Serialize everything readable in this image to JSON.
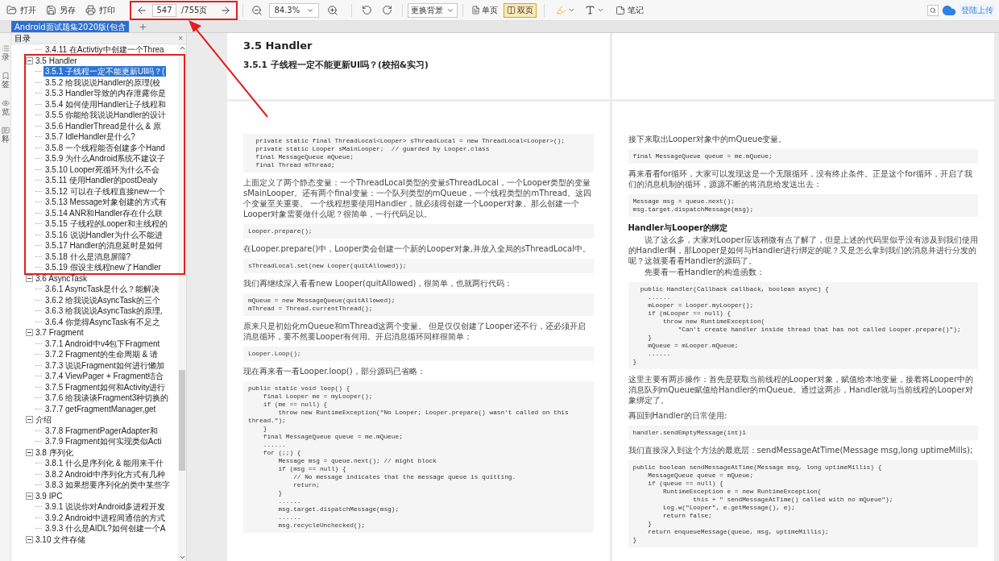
{
  "toolbar": {
    "file_buttons": [
      {
        "label": "打开"
      },
      {
        "label": "另存"
      },
      {
        "label": "打印"
      }
    ],
    "page_input": {
      "value": "547"
    },
    "page_total": "/755页",
    "zoom": {
      "value": "84.3%"
    },
    "background_button": "更换背景",
    "view_modes": [
      {
        "label": "单页",
        "selected": false
      },
      {
        "label": "双页",
        "selected": true
      }
    ],
    "note_button": "笔记",
    "upload_button": "登陆上传"
  },
  "document_tab": {
    "title": "Android面试题集2020版(包含"
  },
  "rail_tabs": [
    {
      "label": "录"
    },
    {
      "label": "签"
    },
    {
      "label": "览"
    },
    {
      "label": "释"
    }
  ],
  "sidebar": {
    "title": "目录",
    "close": "×",
    "items": [
      {
        "label": "3.4.11 在Activtiy中创建一个Threa",
        "selected": false
      },
      {
        "label": "3.5 Handler",
        "expanded": true,
        "children": [
          {
            "label": "3.5.1 子线程一定不能更新UI吗？(",
            "selected": true
          },
          {
            "label": "3.5.2 给我说说Handler的原理(校",
            "selected": false
          },
          {
            "label": "3.5.3 Handler导致的内存泄露你是",
            "selected": false
          },
          {
            "label": "3.5.4 如何使用Handler让子线程和",
            "selected": false
          },
          {
            "label": "3.5.5 你能给我说说Handler的设计",
            "selected": false
          },
          {
            "label": "3.5.6 HandlerThread是什么 & 原",
            "selected": false
          },
          {
            "label": "3.5.7 IdleHandler是什么?",
            "selected": false
          },
          {
            "label": "3.5.8 一个线程能否创建多个Hand",
            "selected": false
          },
          {
            "label": "3.5.9 为什么Android系统不建议子",
            "selected": false
          },
          {
            "label": "3.5.10 Looper死循环为什么不会",
            "selected": false
          },
          {
            "label": "3.5.11 使用Handler的postDealy",
            "selected": false
          },
          {
            "label": "3.5.12 可以在子线程直接new一个",
            "selected": false
          },
          {
            "label": "3.5.13 Message对象创建的方式有",
            "selected": false
          },
          {
            "label": "3.5.14 ANR和Handler存在什么联",
            "selected": false
          },
          {
            "label": "3.5.15 子线程的Looper和主线程的",
            "selected": false
          },
          {
            "label": "3.5.16 说说Handler为什么不能进",
            "selected": false
          },
          {
            "label": "3.5.17 Handler的消息延时是如何",
            "selected": false
          },
          {
            "label": "3.5.18 什么是消息屏障?",
            "selected": false
          },
          {
            "label": "3.5.19 假设主线程new了Handler",
            "selected": false
          }
        ]
      },
      {
        "label": "3.6 AsyncTask",
        "expanded": true,
        "children": [
          {
            "label": "3.6.1 AsyncTask是什么？能解决",
            "selected": false
          },
          {
            "label": "3.6.2 给我说说AsyncTask的三个",
            "selected": false
          },
          {
            "label": "3.6.3 给我说说AsyncTask的原理,",
            "selected": false
          },
          {
            "label": "3.6.4 你觉得AsyncTask有不足之",
            "selected": false
          }
        ]
      },
      {
        "label": "3.7 Fragment",
        "expanded": true,
        "children": [
          {
            "label": "3.7.1 Android中v4包下Fragment",
            "selected": false
          },
          {
            "label": "3.7.2 Fragment的生命周期 & 请",
            "selected": false
          },
          {
            "label": "3.7.3 说说Fragment如何进行懒加",
            "selected": false
          },
          {
            "label": "3.7.4 ViewPager + Fragment结合",
            "selected": false
          },
          {
            "label": "3.7.5 Fragment如何和Activity进行",
            "selected": false
          },
          {
            "label": "3.7.6 给我谈谈Fragment3种切换的",
            "selected": false
          },
          {
            "label": "3.7.7 getFragmentManager,get",
            "selected": false
          }
        ]
      },
      {
        "label": "介绍",
        "expanded": true,
        "children": [
          {
            "label": "3.7.8 FragmentPagerAdapter和",
            "selected": false
          },
          {
            "label": "3.7.9 Fragment如何实现类似Acti",
            "selected": false
          }
        ]
      },
      {
        "label": "3.8 序列化",
        "expanded": true,
        "children": [
          {
            "label": "3.8.1 什么是序列化 & 能用来干什",
            "selected": false
          },
          {
            "label": "3.8.2 Android中序列化方式有几种",
            "selected": false
          },
          {
            "label": "3.8.3 如果想要序列化的类中某些字",
            "selected": false
          }
        ]
      },
      {
        "label": "3.9 IPC",
        "expanded": true,
        "children": [
          {
            "label": "3.9.1 说说你对Android多进程开发",
            "selected": false
          },
          {
            "label": "3.9.2 Android中进程间通信的方式",
            "selected": false
          },
          {
            "label": "3.9.3 什么是AIDL?如何创建一个A",
            "selected": false
          }
        ]
      },
      {
        "label": "3.10 文件存储",
        "expanded": true
      }
    ]
  },
  "pages": [
    {
      "kind": "text",
      "blocks": [
        {
          "kind": "title",
          "text": "3.5 Handler"
        },
        {
          "kind": "subtitle",
          "text": "3.5.1 子线程一定不能更新UI吗？(校招&实习)"
        }
      ]
    },
    {
      "kind": "blank"
    },
    {
      "kind": "text",
      "blocks": [
        {
          "kind": "code",
          "lines": [
            "  private static final ThreadLocal<Looper> sThreadLocal = new ThreadLocal<Looper>();",
            "  private static Looper sMainLooper;  // guarded by Looper.class",
            "  final MessageQueue mQueue;",
            "  final Thread mThread;"
          ]
        },
        {
          "kind": "para",
          "text": "上面定义了两个静态变量：一个ThreadLocal类型的变量sThreadLocal，一个Looper类型的变量sMainLooper。还有两个final变量：一个队列类型的mQueue，一个线程类型的mThread。这四个变量至关重要。 一个线程想要使用Handler，就必须得创建一个Looper对象。那么创建一个Looper对象需要做什么呢？很简单，一行代码足以。"
        },
        {
          "kind": "code",
          "lines": [
            "Looper.prepare();"
          ]
        },
        {
          "kind": "para",
          "text": "在Looper.prepare()中，Looper类会创建一个新的Looper对象,并放入全局的sThreadLocal中。"
        },
        {
          "kind": "code",
          "lines": [
            "sThreadLocal.set(new Looper(quitAllowed));"
          ]
        },
        {
          "kind": "para",
          "text": "我们再继续深入看看new Looper(quitAllowed)，很简单，也就两行代码："
        },
        {
          "kind": "code",
          "lines": [
            "mQueue = new MessageQueue(quitAllowed);",
            "mThread = Thread.currentThread();"
          ]
        },
        {
          "kind": "para",
          "text": "原来只是初始化mQueue和mThread这两个变量。 但是仅仅创建了Looper还不行，还必须开启消息循环，要不然要Looper有何用。开启消息循环同样很简单："
        },
        {
          "kind": "code",
          "lines": [
            "Looper.Loop();"
          ]
        },
        {
          "kind": "para",
          "text": "现在再来看一看Looper.loop()，部分源码已省略："
        },
        {
          "kind": "code",
          "lines": [
            "public static void loop() {",
            "    final Looper me = myLooper();",
            "    if (me == null) {",
            "        throw new RuntimeException(\"No Looper; Looper.prepare() wasn't called on this",
            "thread.\");",
            "    }",
            "    final MessageQueue queue = me.mQueue;",
            "    ......",
            "    for (;;) {",
            "        Message msg = queue.next(); // might block",
            "        if (msg == null) {",
            "            // No message indicates that the message queue is quitting.",
            "            return;",
            "        }",
            "        ......",
            "        msg.target.dispatchMessage(msg);",
            "        ......",
            "        msg.recycleUnchecked();"
          ]
        }
      ]
    },
    {
      "kind": "text",
      "blocks": [
        {
          "kind": "para",
          "text": "接下来取出Looper对象中的mQueue变量。"
        },
        {
          "kind": "code",
          "lines": [
            "final MessageQueue queue = me.mQueue;"
          ]
        },
        {
          "kind": "para",
          "text": "再来看看for循环，大家可以发现这是一个无限循环，没有终止条件。正是这个for循环，开启了我们的消息机制的循环，源源不断的将消息给发送出去："
        },
        {
          "kind": "code",
          "lines": [
            "Message msg = queue.next();",
            "msg.target.dispatchMessage(msg);"
          ]
        },
        {
          "kind": "subheading",
          "text": "Handler与Looper的绑定"
        },
        {
          "kind": "indented",
          "text": "说了这么多，大家对Looper应该稍微有点了解了，但是上述的代码里似乎没有涉及到我们使用的Handler啊，那Looper是如何与Handler进行绑定的呢？又是怎么拿到我们的消息并进行分发的呢？这就要看看Handler的源码了。"
        },
        {
          "kind": "indented",
          "text": "先要看一看Handler的构造函数："
        },
        {
          "kind": "code",
          "lines": [
            "  public Handler(Callback callback, boolean async) {",
            "    ......",
            "    mLooper = Looper.myLooper();",
            "    if (mLooper == null) {",
            "        throw new RuntimeException(",
            "            \"Can't create handler inside thread that has not called Looper.prepare()\");",
            "    }",
            "    mQueue = mLooper.mQueue;",
            "    ......",
            "}"
          ]
        },
        {
          "kind": "para",
          "text": "这里主要有两步操作：首先是获取当前线程的Looper对象，赋值给本地变量，接着将Looper中的消息队列mQueue赋值给Handler的mQueue。通过这两步，Handler就与当前线程的Looper对象绑定了。"
        },
        {
          "kind": "para",
          "text": "再回到Handler的日常使用:"
        },
        {
          "kind": "code",
          "lines": [
            "handler.sendEmptyMessage(int)1"
          ]
        },
        {
          "kind": "para",
          "text": "我们直接深入到这个方法的最底层：sendMessageAtTime(Message msg,long uptimeMills);"
        },
        {
          "kind": "code",
          "lines": [
            "public boolean sendMessageAtTime(Message msg, long uptimeMillis) {",
            "    MessageQueue queue = mQueue;",
            "    if (queue == null) {",
            "        RuntimeException e = new RuntimeException(",
            "                this + \" sendMessageAtTime() called with no mQueue\");",
            "        Log.w(\"Looper\", e.getMessage(), e);",
            "        return false;",
            "    }",
            "    return enqueueMessage(queue, msg, uptimeMillis);",
            "}"
          ]
        }
      ]
    }
  ]
}
